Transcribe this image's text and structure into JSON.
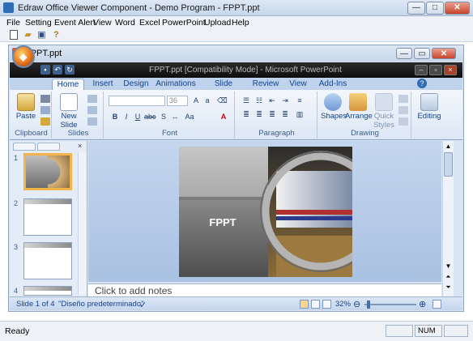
{
  "window": {
    "title": "Edraw Office Viewer Component - Demo Program - FPPT.ppt",
    "min": "—",
    "max": "□",
    "close": "✕"
  },
  "menu": [
    "File",
    "Setting",
    "Event Alert",
    "View",
    "Word",
    "Excel",
    "PowerPoint",
    "Upload",
    "Help"
  ],
  "toolbar_icons": [
    "new-document-icon",
    "open-folder-icon",
    "save-icon",
    "help-icon"
  ],
  "document": {
    "title": "FPPT.ppt"
  },
  "office": {
    "title": "FPPT.ppt [Compatibility Mode] - Microsoft PowerPoint",
    "tabs": [
      "Home",
      "Insert",
      "Design",
      "Animations",
      "Slide Show",
      "Review",
      "View",
      "Add-Ins"
    ],
    "active_tab": "Home"
  },
  "ribbon": {
    "clipboard": {
      "label": "Clipboard",
      "paste": "Paste"
    },
    "slides": {
      "label": "Slides",
      "new_slide": "New Slide"
    },
    "font": {
      "label": "Font",
      "size": "36"
    },
    "paragraph": {
      "label": "Paragraph"
    },
    "drawing": {
      "label": "Drawing",
      "shapes": "Shapes",
      "arrange": "Arrange",
      "quick_styles": "Quick Styles"
    },
    "editing": {
      "label": "Editing"
    }
  },
  "slides_panel": {
    "thumbs": [
      "1",
      "2",
      "3",
      "4"
    ],
    "selected": "1"
  },
  "slide": {
    "title": "FPPT"
  },
  "notes": {
    "placeholder": "Click to add notes"
  },
  "ppt_status": {
    "slide_info": "Slide 1 of 4",
    "theme": "\"Diseño predeterminado\"",
    "zoom": "32%",
    "zoom_level": 0.32
  },
  "status": {
    "ready": "Ready",
    "num": "NUM"
  },
  "colors": {
    "accent": "#15428b",
    "orb": "#e6731e",
    "selected_thumb": "#f4b24b"
  }
}
